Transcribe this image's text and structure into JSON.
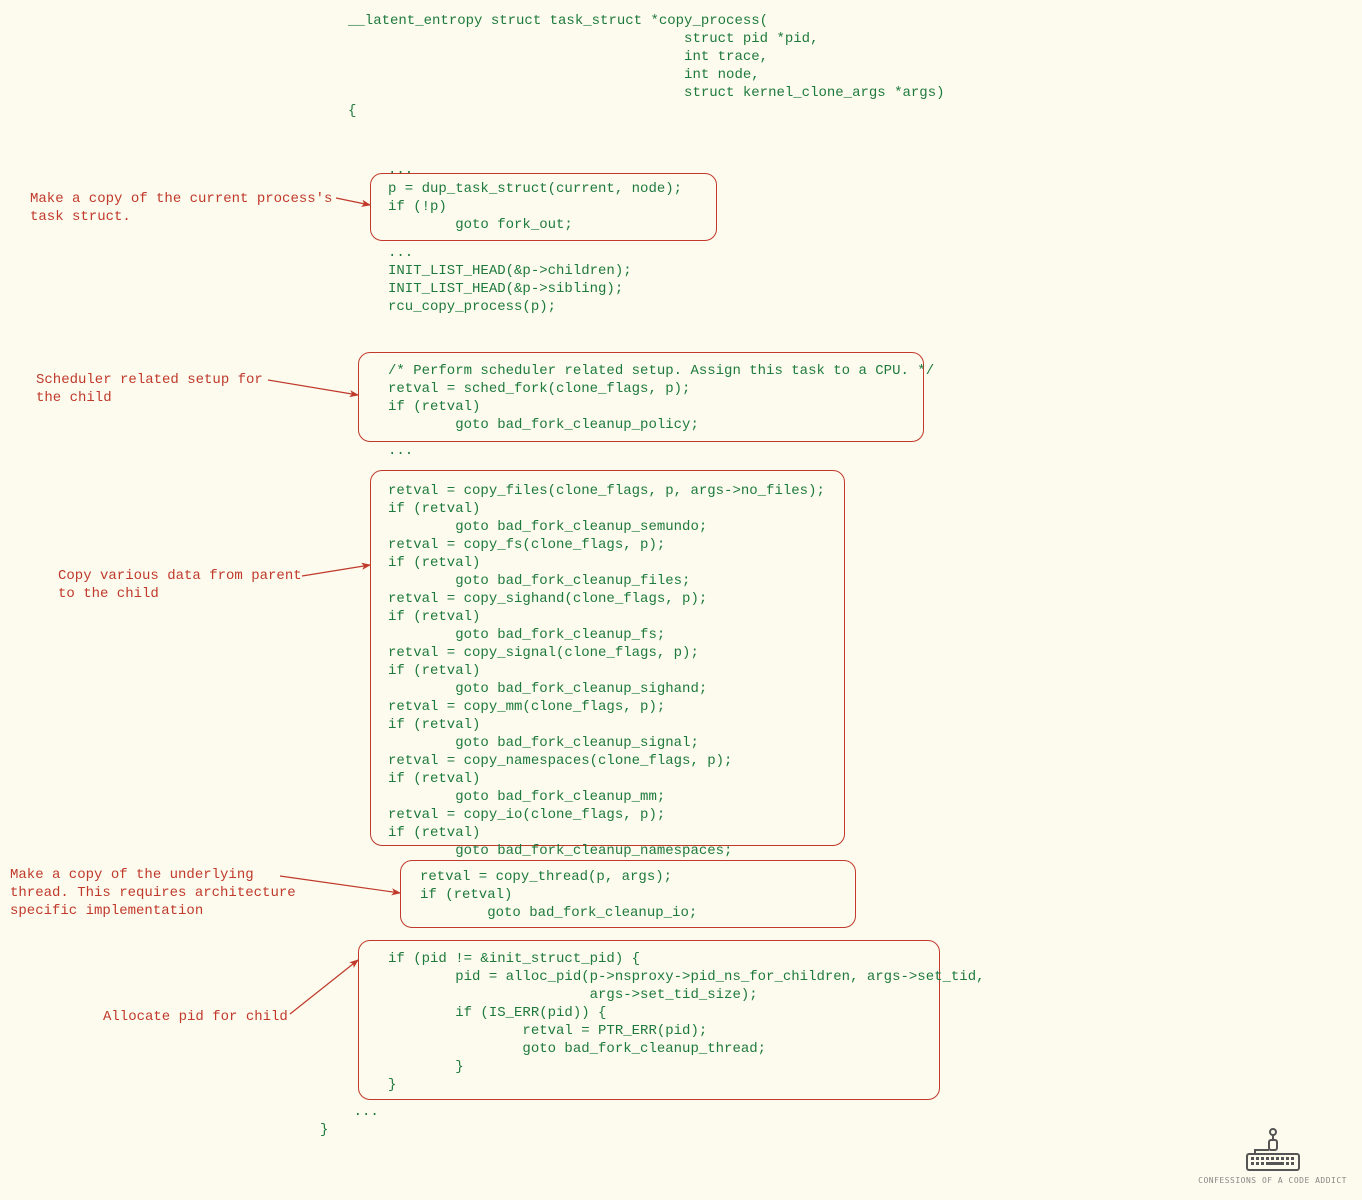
{
  "signature": "__latent_entropy struct task_struct *copy_process(\n                                        struct pid *pid,\n                                        int trace,\n                                        int node,\n                                        struct kernel_clone_args *args)\n{",
  "ellipsis": "...",
  "box1": "p = dup_task_struct(current, node);\nif (!p)\n        goto fork_out;",
  "mid1": "...\nINIT_LIST_HEAD(&p->children);\nINIT_LIST_HEAD(&p->sibling);\nrcu_copy_process(p);",
  "box2": "/* Perform scheduler related setup. Assign this task to a CPU. */\nretval = sched_fork(clone_flags, p);\nif (retval)\n        goto bad_fork_cleanup_policy;",
  "box3": "retval = copy_files(clone_flags, p, args->no_files);\nif (retval)\n        goto bad_fork_cleanup_semundo;\nretval = copy_fs(clone_flags, p);\nif (retval)\n        goto bad_fork_cleanup_files;\nretval = copy_sighand(clone_flags, p);\nif (retval)\n        goto bad_fork_cleanup_fs;\nretval = copy_signal(clone_flags, p);\nif (retval)\n        goto bad_fork_cleanup_sighand;\nretval = copy_mm(clone_flags, p);\nif (retval)\n        goto bad_fork_cleanup_signal;\nretval = copy_namespaces(clone_flags, p);\nif (retval)\n        goto bad_fork_cleanup_mm;\nretval = copy_io(clone_flags, p);\nif (retval)\n        goto bad_fork_cleanup_namespaces;",
  "box4": "retval = copy_thread(p, args);\nif (retval)\n        goto bad_fork_cleanup_io;",
  "box5": "if (pid != &init_struct_pid) {\n        pid = alloc_pid(p->nsproxy->pid_ns_for_children, args->set_tid,\n                        args->set_tid_size);\n        if (IS_ERR(pid)) {\n                retval = PTR_ERR(pid);\n                goto bad_fork_cleanup_thread;\n        }\n}",
  "closing": "    ...\n}",
  "ann1": "Make a copy of the current process's\ntask struct.",
  "ann2": "Scheduler related setup for\nthe child",
  "ann3": "Copy various data from parent\nto the child",
  "ann4": "Make a copy of the underlying\nthread. This requires architecture\nspecific implementation",
  "ann5": "Allocate pid for child",
  "watermark": "CONFESSIONS OF A CODE ADDICT"
}
